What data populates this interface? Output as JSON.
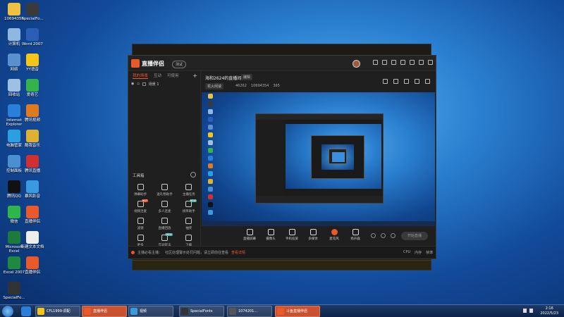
{
  "desktop": {
    "icons": [
      {
        "label": "10694354",
        "color": "#f0c040"
      },
      {
        "label": "SpecialFo...",
        "color": "#3a3a3a"
      },
      {
        "label": "计算机",
        "color": "#8fb8e0"
      },
      {
        "label": "Word 2007",
        "color": "#2b5eb5"
      },
      {
        "label": "网络",
        "color": "#5a8fd0"
      },
      {
        "label": "YY语音",
        "color": "#f5c518"
      },
      {
        "label": "回收站",
        "color": "#9fc0e0"
      },
      {
        "label": "爱奇艺",
        "color": "#33b34a"
      },
      {
        "label": "Internet Explorer",
        "color": "#2a7fd8"
      },
      {
        "label": "腾讯视频",
        "color": "#e07a1f"
      },
      {
        "label": "电脑管家",
        "color": "#2aa0e0"
      },
      {
        "label": "酷我音乐",
        "color": "#e0b030"
      },
      {
        "label": "控制面板",
        "color": "#4a8fd0"
      },
      {
        "label": "腾讯直播",
        "color": "#d03030"
      },
      {
        "label": "腾讯QQ",
        "color": "#111111"
      },
      {
        "label": "暴风影音",
        "color": "#3a9ae0"
      },
      {
        "label": "微信",
        "color": "#2db74a"
      },
      {
        "label": "直播伴侣",
        "color": "#e9592a"
      },
      {
        "label": "Microsoft Excel",
        "color": "#1d7a3a"
      },
      {
        "label": "新建文本文档",
        "color": "#eeeeee"
      },
      {
        "label": "Excel 2007",
        "color": "#1f8a3f"
      },
      {
        "label": "直播伴侣",
        "color": "#e9592a"
      },
      {
        "label": "SpecialFo...",
        "color": "#333333"
      }
    ]
  },
  "window": {
    "app_name": "直播伴侣",
    "version_badge": "测试",
    "tabs": [
      "我的场景",
      "互动",
      "可使用"
    ],
    "scene_name": "场景 1",
    "room_title": "海和2624的直播间",
    "room_edit": "编辑",
    "category": "花火闲谈",
    "stats": [
      "46262",
      "10694354",
      "365"
    ],
    "tools_title": "工具箱",
    "tools": [
      {
        "label": "弹幕助手",
        "badge": ""
      },
      {
        "label": "送礼物助手",
        "badge": ""
      },
      {
        "label": "主播任务",
        "badge": ""
      },
      {
        "label": "视频连麦",
        "badge": "HOT"
      },
      {
        "label": "多人连麦",
        "badge": ""
      },
      {
        "label": "榜单助手",
        "badge": "NEW"
      },
      {
        "label": "滤镜",
        "badge": ""
      },
      {
        "label": "直播回放",
        "badge": ""
      },
      {
        "label": "抽奖",
        "badge": ""
      },
      {
        "label": "更多",
        "badge": ""
      },
      {
        "label": "互动玩法",
        "badge": "NEW"
      },
      {
        "label": "下载",
        "badge": ""
      }
    ],
    "bottom_tools": [
      "直播屏幕",
      "摄像头",
      "手机投屏",
      "多媒体",
      "麦克风",
      "扬声器"
    ],
    "start_button": "开始直播",
    "notice_prefix": "主播必看主播：",
    "notice_text": "社区处理警示处罚问题，请立即前往查看",
    "notice_link": "查看详情",
    "status_metrics": [
      "CPU",
      "内存",
      "帧率"
    ]
  },
  "taskbar": {
    "items": [
      {
        "label": "CFL1999-调配",
        "color": "#f5c518",
        "active": false
      },
      {
        "label": "直播伴侣",
        "color": "#e9592a",
        "active": true
      },
      {
        "label": "视频",
        "color": "#3a9ae0",
        "active": false
      },
      {
        "label": "SpecialFonts",
        "color": "#333333",
        "active": false
      },
      {
        "label": "1074201...",
        "color": "#555555",
        "active": false
      },
      {
        "label": "斗鱼直播伴侣",
        "color": "#e9592a",
        "active": true
      }
    ],
    "time": "2:16",
    "date": "2022/5/23"
  }
}
